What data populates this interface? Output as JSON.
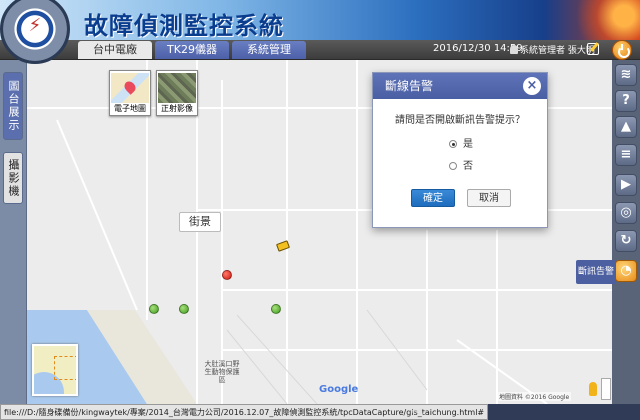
{
  "header": {
    "app_title": "故障偵測監控系統"
  },
  "nav": {
    "tabs": [
      {
        "label": "台中電廠"
      },
      {
        "label": "TK29儀器"
      },
      {
        "label": "系統管理"
      }
    ],
    "datetime": "2016/12/30 14:59",
    "user": "系統管理者 張大明"
  },
  "left_panel": {
    "tabs": [
      {
        "label": "圖台展示"
      },
      {
        "label": "攝影機"
      }
    ]
  },
  "map": {
    "layers": [
      {
        "label": "電子地圖"
      },
      {
        "label": "正射影像"
      }
    ],
    "street_view_button": "街景",
    "place_label": "大肚溪口野生動物保護區",
    "google": "Google",
    "attribution": "地圖資料 ©2016 Google"
  },
  "right_toolbar": {
    "icons": [
      "layers-icon",
      "help-icon",
      "warning-icon",
      "list-icon",
      "camera-icon",
      "locate-icon",
      "refresh-icon",
      "alarm-icon"
    ],
    "alarm_flyout_label": "斷訊告警"
  },
  "dialog": {
    "title": "斷線告警",
    "question": "請問是否開啟斷訊告警提示？",
    "options": [
      {
        "label": "是",
        "selected": true
      },
      {
        "label": "否",
        "selected": false
      }
    ],
    "ok_label": "確定",
    "cancel_label": "取消"
  },
  "status": {
    "url": "file:///D:/隨身碟備份/kingwaytek/專案/2014_台灣電力公司/2016.12.07_故障偵測監控系統/tpcDataCapture/gis_taichung.html#",
    "tail": "ed."
  },
  "colors": {
    "accent": "#4a5ea3",
    "nav_bg": "#3c3c3c",
    "marker_red": "#d0150e",
    "marker_green": "#3e9d1f"
  }
}
